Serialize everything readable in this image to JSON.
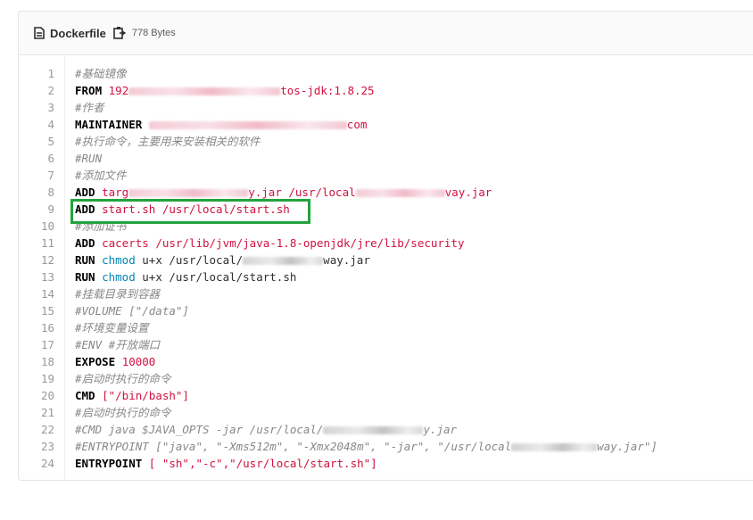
{
  "header": {
    "file_name": "Dockerfile",
    "file_icon": "file-text-icon",
    "copy_icon": "clipboard-icon",
    "file_size": "778 Bytes"
  },
  "highlight_color": "#22a33c",
  "lines": [
    {
      "n": "1",
      "tokens": [
        {
          "t": "cm",
          "v": "#基础镜像"
        }
      ]
    },
    {
      "n": "2",
      "tokens": [
        {
          "t": "kw",
          "v": "FROM "
        },
        {
          "t": "str",
          "v": "192"
        },
        {
          "t": "blur",
          "w": 170
        },
        {
          "t": "str",
          "v": "tos-jdk:1.8.25"
        }
      ]
    },
    {
      "n": "3",
      "tokens": [
        {
          "t": "cm",
          "v": "#作者"
        }
      ]
    },
    {
      "n": "4",
      "tokens": [
        {
          "t": "kw",
          "v": "MAINTAINER "
        },
        {
          "t": "blur",
          "w": 222
        },
        {
          "t": "str",
          "v": "com"
        }
      ]
    },
    {
      "n": "5",
      "tokens": [
        {
          "t": "cm",
          "v": "#执行命令，主要用来安装相关的软件"
        }
      ]
    },
    {
      "n": "6",
      "tokens": [
        {
          "t": "cm",
          "v": "#RUN"
        }
      ]
    },
    {
      "n": "7",
      "tokens": [
        {
          "t": "cm",
          "v": "#添加文件"
        }
      ]
    },
    {
      "n": "8",
      "tokens": [
        {
          "t": "kw",
          "v": "ADD "
        },
        {
          "t": "str",
          "v": "targ"
        },
        {
          "t": "blur",
          "w": 134
        },
        {
          "t": "str",
          "v": "y.jar /usr/local"
        },
        {
          "t": "blur",
          "w": 100
        },
        {
          "t": "str",
          "v": "vay.jar"
        }
      ]
    },
    {
      "n": "9",
      "tokens": [
        {
          "t": "kw",
          "v": "ADD "
        },
        {
          "t": "str",
          "v": "start.sh /usr/local/start.sh"
        }
      ]
    },
    {
      "n": "10",
      "tokens": [
        {
          "t": "cm",
          "v": "#添加证书"
        }
      ]
    },
    {
      "n": "11",
      "tokens": [
        {
          "t": "kw",
          "v": "ADD "
        },
        {
          "t": "str",
          "v": "cacerts /usr/lib/jvm/java-1.8-openjdk/jre/lib/security"
        }
      ]
    },
    {
      "n": "12",
      "tokens": [
        {
          "t": "kw",
          "v": "RUN "
        },
        {
          "t": "fn",
          "v": "chmod"
        },
        {
          "t": "txt",
          "v": " u+x /usr/local/"
        },
        {
          "t": "blurgrey",
          "w": 90
        },
        {
          "t": "txt",
          "v": "way.jar"
        }
      ]
    },
    {
      "n": "13",
      "tokens": [
        {
          "t": "kw",
          "v": "RUN "
        },
        {
          "t": "fn",
          "v": "chmod"
        },
        {
          "t": "txt",
          "v": " u+x /usr/local/start.sh"
        }
      ]
    },
    {
      "n": "14",
      "tokens": [
        {
          "t": "cm",
          "v": "#挂载目录到容器"
        }
      ]
    },
    {
      "n": "15",
      "tokens": [
        {
          "t": "cm",
          "v": "#VOLUME [\"/data\"]"
        }
      ]
    },
    {
      "n": "16",
      "tokens": [
        {
          "t": "cm",
          "v": "#环境变量设置"
        }
      ]
    },
    {
      "n": "17",
      "tokens": [
        {
          "t": "cm",
          "v": "#ENV #开放端口"
        }
      ]
    },
    {
      "n": "18",
      "tokens": [
        {
          "t": "kw",
          "v": "EXPOSE "
        },
        {
          "t": "str",
          "v": "10000"
        }
      ]
    },
    {
      "n": "19",
      "tokens": [
        {
          "t": "cm",
          "v": "#启动时执行的命令"
        }
      ]
    },
    {
      "n": "20",
      "tokens": [
        {
          "t": "kw",
          "v": "CMD "
        },
        {
          "t": "str",
          "v": "[\"/bin/bash\"]"
        }
      ]
    },
    {
      "n": "21",
      "tokens": [
        {
          "t": "cm",
          "v": "#启动时执行的命令"
        }
      ]
    },
    {
      "n": "22",
      "tokens": [
        {
          "t": "cm",
          "v": "#CMD java $JAVA_OPTS -jar /usr/local/"
        },
        {
          "t": "blurgrey",
          "w": 112
        },
        {
          "t": "cm",
          "v": "y.jar"
        }
      ]
    },
    {
      "n": "23",
      "tokens": [
        {
          "t": "cm",
          "v": "#ENTRYPOINT [\"java\", \"-Xms512m\", \"-Xmx2048m\", \"-jar\", \"/usr/local"
        },
        {
          "t": "blurgrey",
          "w": 96
        },
        {
          "t": "cm",
          "v": "way.jar\"]"
        }
      ]
    },
    {
      "n": "24",
      "tokens": [
        {
          "t": "kw",
          "v": "ENTRYPOINT "
        },
        {
          "t": "str",
          "v": "[ \"sh\",\"-c\",\"/usr/local/start.sh\"]"
        }
      ]
    }
  ]
}
